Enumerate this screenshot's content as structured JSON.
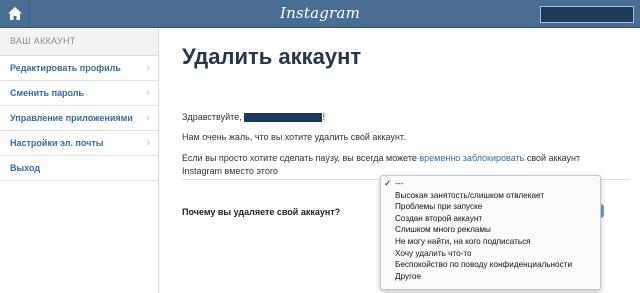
{
  "header": {
    "logo": "Instagram",
    "home_icon": "home-icon"
  },
  "sidebar": {
    "heading": "ВАШ АККАУНТ",
    "items": [
      {
        "label": "Редактировать профиль"
      },
      {
        "label": "Сменить пароль"
      },
      {
        "label": "Управление приложениями"
      },
      {
        "label": "Настройки эл. почты"
      },
      {
        "label": "Выход"
      }
    ]
  },
  "main": {
    "title": "Удалить аккаунт",
    "greeting_prefix": "Здравствуйте,",
    "greeting_suffix": "!",
    "sorry": "Нам очень жаль, что вы хотите удалить свой аккаунт.",
    "pause_before": "Если вы просто хотите сделать паузу, вы всегда можете ",
    "pause_link": "временно заблокировать",
    "pause_after": " свой аккаунт Instagram вместо этого",
    "question": "Почему вы удаляете свой аккаунт?"
  },
  "dropdown": {
    "selected_index": 0,
    "options": [
      "---",
      "Высокая занятость/слишком отвлекает",
      "Проблемы при запуске",
      "Создан второй аккаунт",
      "Слишком много рекламы",
      "Не могу найти, на кого подписаться",
      "Хочу удалить что-то",
      "Беспокойство по поводу конфиденциальности",
      "Другое"
    ]
  },
  "colors": {
    "topbar": "#4a6d94",
    "link": "#3a6a9b",
    "title": "#263748",
    "annotation_arrow": "#e8402a",
    "select_edge": "#6f9fd6"
  }
}
